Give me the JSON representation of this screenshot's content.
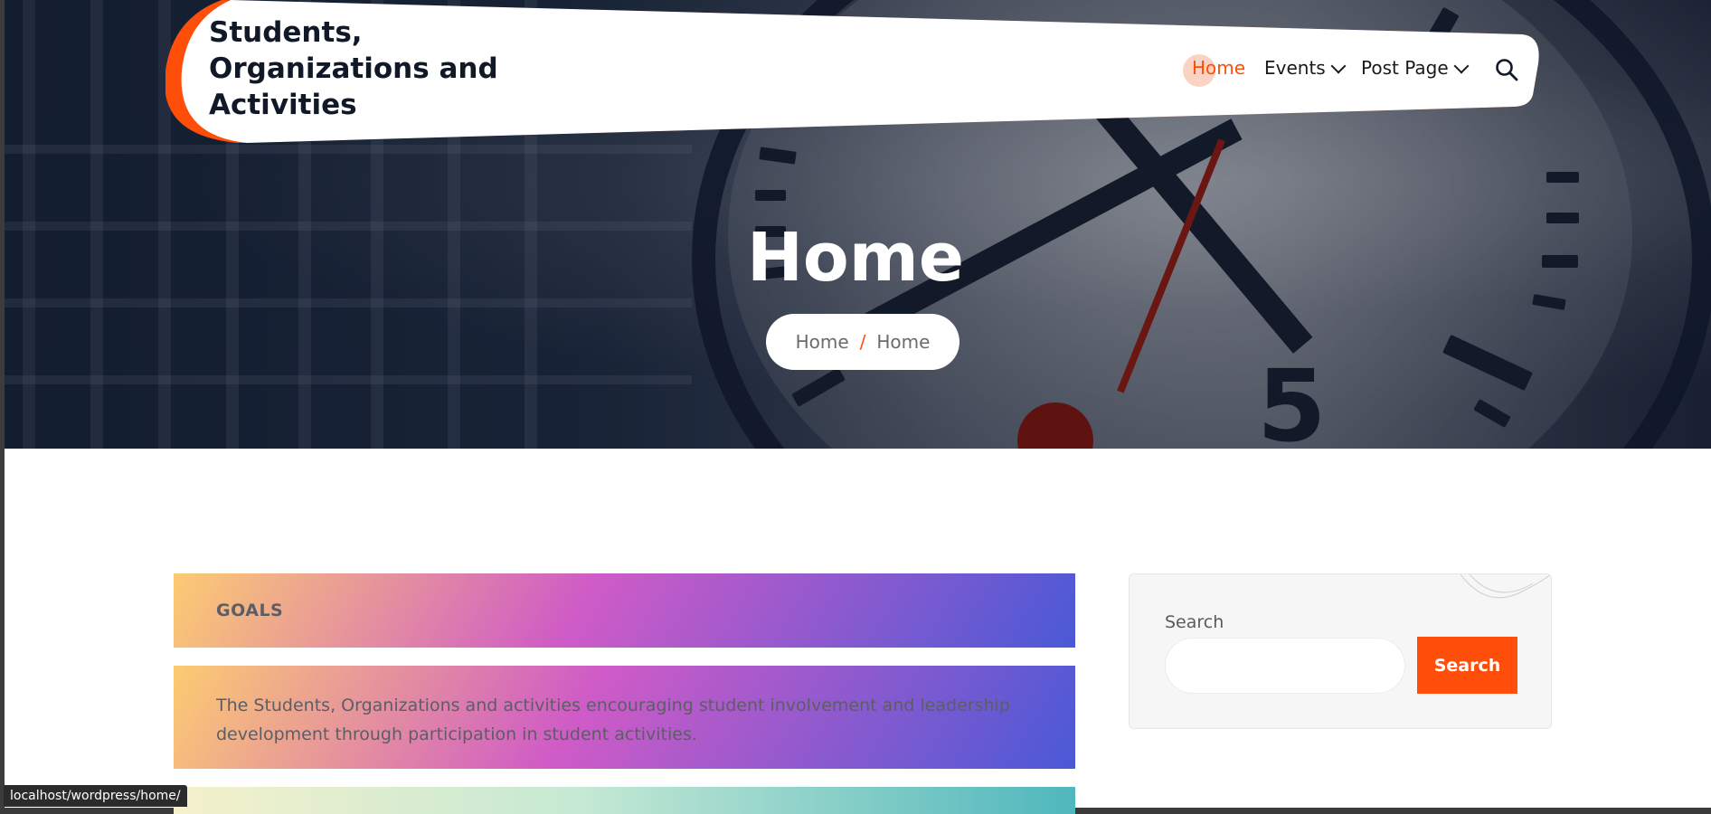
{
  "site": {
    "title": "Students, Organizations and Activities",
    "accent_color": "#ff4d0a"
  },
  "nav": {
    "items": [
      {
        "label": "Home",
        "active": true
      },
      {
        "label": "Events",
        "has_dropdown": true
      },
      {
        "label": "Post Page",
        "has_dropdown": true
      }
    ],
    "search_icon": "search-icon"
  },
  "hero": {
    "title": "Home",
    "breadcrumb": [
      "Home",
      "/",
      "Home"
    ]
  },
  "content": {
    "goals_heading": "GOALS",
    "goals_text": "The Students, Organizations and activities encouraging student involvement and leadership development through participation in student activities."
  },
  "sidebar": {
    "search_label": "Search",
    "search_value": "",
    "search_button": "Search"
  },
  "status_bar": {
    "url": "localhost/wordpress/home/"
  }
}
